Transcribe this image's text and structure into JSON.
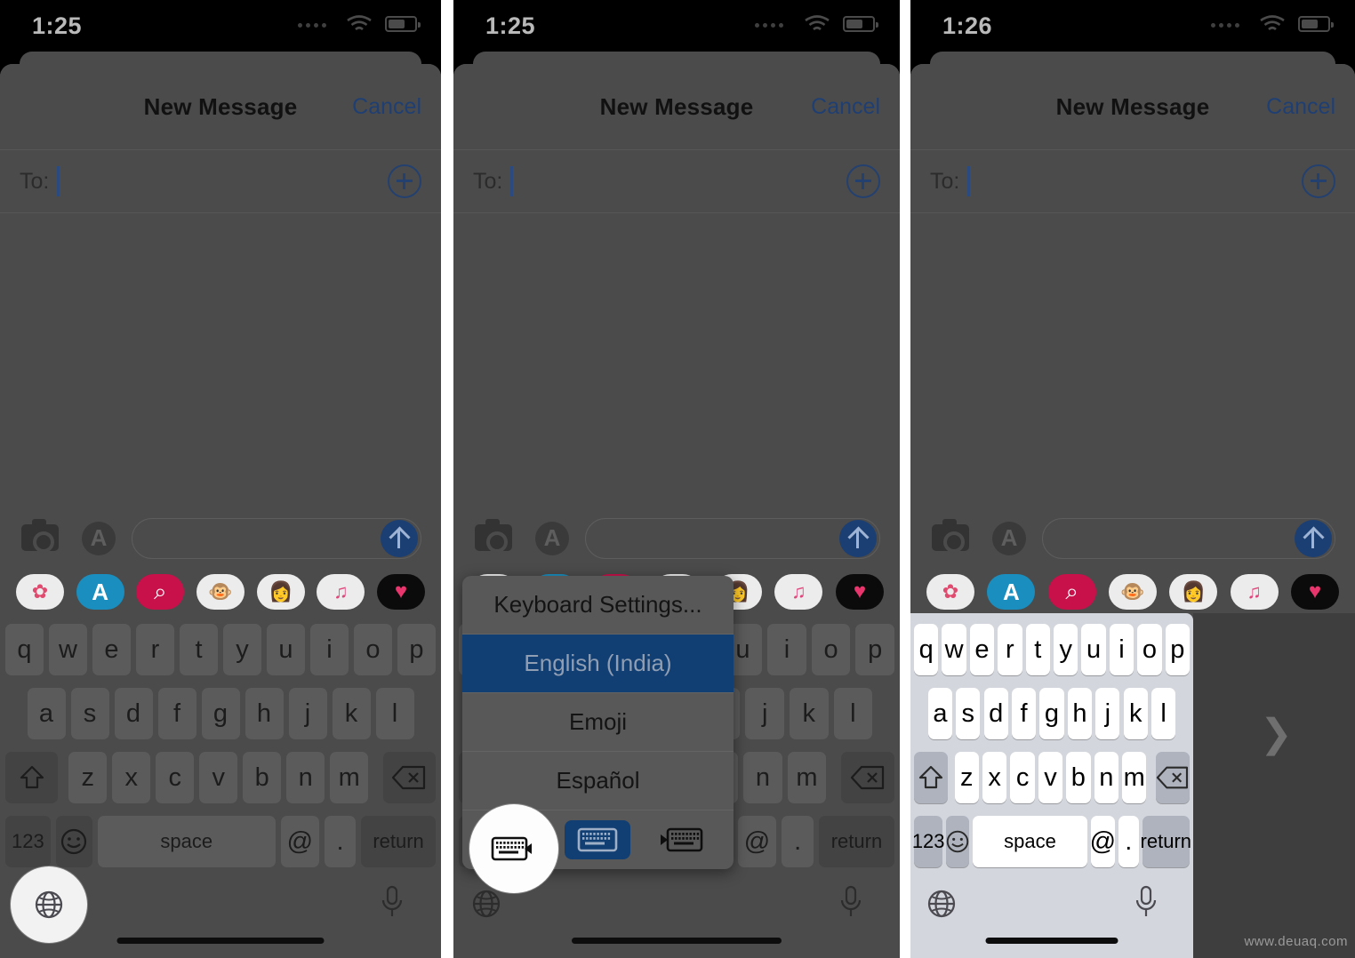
{
  "meta": {
    "watermark": "www.deuaq.com"
  },
  "panels": [
    {
      "id": "panel-1-globe-key",
      "status": {
        "time": "1:25",
        "wifi_icon": "wifi-icon",
        "battery_icon": "battery-icon",
        "signal_icon": "signal-dots-icon"
      },
      "nav": {
        "title": "New Message",
        "cancel_label": "Cancel"
      },
      "to_row": {
        "label": "To:",
        "value": "",
        "add_contact_icon": "plus-circle-icon"
      },
      "compose": {
        "camera_icon": "camera-icon",
        "appstore_icon": "app-store-icon",
        "placeholder": "",
        "send_icon": "send-arrow-up-icon"
      },
      "keyboard": {
        "lit": false,
        "one_handed": false,
        "globe_highlighted": true,
        "mic_icon": "microphone-icon",
        "globe_icon": "globe-icon"
      }
    },
    {
      "id": "panel-2-keyboard-menu",
      "status": {
        "time": "1:25",
        "wifi_icon": "wifi-icon",
        "battery_icon": "battery-icon",
        "signal_icon": "signal-dots-icon"
      },
      "nav": {
        "title": "New Message",
        "cancel_label": "Cancel"
      },
      "to_row": {
        "label": "To:",
        "value": "",
        "add_contact_icon": "plus-circle-icon"
      },
      "compose": {
        "camera_icon": "camera-icon",
        "appstore_icon": "app-store-icon",
        "placeholder": "",
        "send_icon": "send-arrow-up-icon"
      },
      "keyboard": {
        "lit": false,
        "one_handed": false,
        "globe_highlighted": false,
        "mic_icon": "microphone-icon",
        "globe_icon": "globe-icon"
      },
      "popup": {
        "items": [
          {
            "label": "Keyboard Settings...",
            "selected": false
          },
          {
            "label": "English (India)",
            "selected": true
          },
          {
            "label": "Emoji",
            "selected": false
          },
          {
            "label": "Español",
            "selected": false
          }
        ],
        "modes": [
          {
            "name": "keyboard-left-handed-icon",
            "selected": false,
            "highlighted": true
          },
          {
            "name": "keyboard-full-width-icon",
            "selected": true,
            "highlighted": false
          },
          {
            "name": "keyboard-right-handed-icon",
            "selected": false,
            "highlighted": false
          }
        ]
      }
    },
    {
      "id": "panel-3-one-handed-keyboard",
      "status": {
        "time": "1:26",
        "wifi_icon": "wifi-icon",
        "battery_icon": "battery-icon",
        "signal_icon": "signal-dots-icon"
      },
      "nav": {
        "title": "New Message",
        "cancel_label": "Cancel"
      },
      "to_row": {
        "label": "To:",
        "value": "",
        "add_contact_icon": "plus-circle-icon"
      },
      "compose": {
        "camera_icon": "camera-icon",
        "appstore_icon": "app-store-icon",
        "placeholder": "",
        "send_icon": "send-arrow-up-icon"
      },
      "keyboard": {
        "lit": true,
        "one_handed": true,
        "globe_highlighted": false,
        "mic_icon": "microphone-icon",
        "globe_icon": "globe-icon",
        "expand_icon": "chevron-right-icon"
      }
    }
  ],
  "keyboard_layout": {
    "row1": [
      "q",
      "w",
      "e",
      "r",
      "t",
      "y",
      "u",
      "i",
      "o",
      "p"
    ],
    "row2": [
      "a",
      "s",
      "d",
      "f",
      "g",
      "h",
      "j",
      "k",
      "l"
    ],
    "row3": [
      "z",
      "x",
      "c",
      "v",
      "b",
      "n",
      "m"
    ],
    "shift_label": "shift-arrow-icon",
    "backspace_label": "backspace-icon",
    "numbers_label": "123",
    "emoji_label": "emoji-face-icon",
    "space_label": "space",
    "at_label": "@",
    "period_label": ".",
    "return_label": "return"
  },
  "app_strip": [
    {
      "name": "photos-app-icon",
      "glyph": "✿",
      "bg": "#ececec",
      "color": "#e04a6e"
    },
    {
      "name": "app-store-app-icon",
      "glyph": "A",
      "bg": "#1a8fbf",
      "color": "#ffffff"
    },
    {
      "name": "image-search-app-icon",
      "glyph": "⌕",
      "bg": "#c8104a",
      "color": "#ffffff"
    },
    {
      "name": "animoji-app-icon",
      "glyph": "🐵",
      "bg": "#ececec",
      "color": "#000000"
    },
    {
      "name": "memoji-app-icon",
      "glyph": "👩",
      "bg": "#ececec",
      "color": "#000000"
    },
    {
      "name": "music-app-icon",
      "glyph": "♫",
      "bg": "#ececec",
      "color": "#e0457b"
    },
    {
      "name": "digital-touch-app-icon",
      "glyph": "♥",
      "bg": "#0b0b0b",
      "color": "#e8356d"
    }
  ]
}
